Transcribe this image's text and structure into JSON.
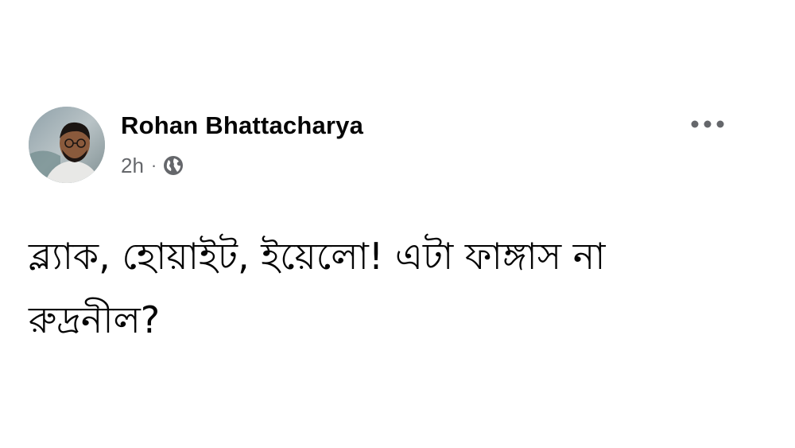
{
  "post": {
    "author": {
      "name": "Rohan Bhattacharya",
      "avatar_icon": "profile-photo"
    },
    "meta": {
      "timestamp": "2h",
      "separator": "·",
      "audience_icon": "globe-icon"
    },
    "menu_icon": "more-horizontal-icon",
    "text_line_1": "ব্ল্যাক, হোয়াইট, ইয়েলো! এটা ফাঙ্গাস না",
    "text_line_2": "রুদ্রনীল?"
  },
  "colors": {
    "text_primary": "#050505",
    "text_secondary": "#65676b",
    "background": "#ffffff"
  }
}
